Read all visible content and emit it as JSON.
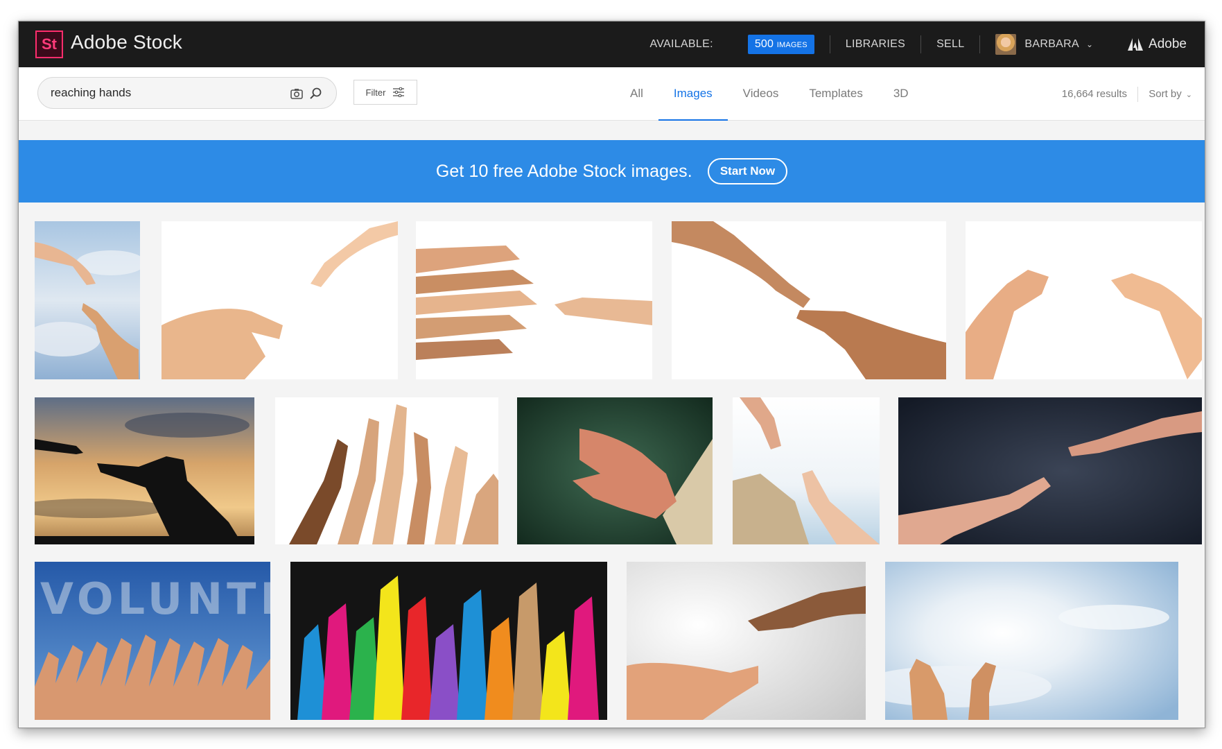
{
  "app": {
    "logo_text": "St",
    "title": "Adobe Stock"
  },
  "topnav": {
    "available_label": "AVAILABLE:",
    "images_count": "500",
    "images_unit": "IMAGES",
    "libraries": "LIBRARIES",
    "sell": "SELL",
    "user": "BARBARA",
    "brand": "Adobe"
  },
  "search": {
    "query": "reaching hands",
    "placeholder": "",
    "filter_label": "Filter"
  },
  "tabs": [
    {
      "label": "All",
      "active": false
    },
    {
      "label": "Images",
      "active": true
    },
    {
      "label": "Videos",
      "active": false
    },
    {
      "label": "Templates",
      "active": false
    },
    {
      "label": "3D",
      "active": false
    }
  ],
  "results": {
    "count_text": "16,664 results",
    "sort_label": "Sort by"
  },
  "banner": {
    "text": "Get 10 free Adobe Stock images.",
    "button": "Start Now"
  },
  "colors": {
    "accent": "#1473e6",
    "banner": "#2d8be6",
    "topbar": "#1b1b1b",
    "logo": "#ff2d6d"
  },
  "images": [
    {
      "id": "sky-hands-reaching"
    },
    {
      "id": "two-hands-white"
    },
    {
      "id": "many-hands-one-hand"
    },
    {
      "id": "hands-reaching-diagonal"
    },
    {
      "id": "two-open-palms"
    },
    {
      "id": "sunset-silhouette-helping"
    },
    {
      "id": "raised-pointing-hands"
    },
    {
      "id": "hand-green-background"
    },
    {
      "id": "rock-rescue-hands"
    },
    {
      "id": "dark-background-hands"
    },
    {
      "id": "volunteer-raised-hands"
    },
    {
      "id": "colorful-hand-silhouettes"
    },
    {
      "id": "reaching-gray-gradient"
    },
    {
      "id": "hands-sunburst-sky"
    }
  ]
}
